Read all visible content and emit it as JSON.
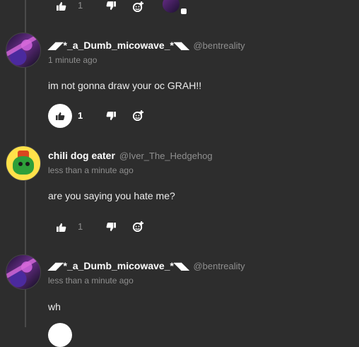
{
  "top_actions": {
    "like_count": "1"
  },
  "comments": [
    {
      "username": "◢◤*_a_Dumb_micowave_*◥◣",
      "handle": "@bentreality",
      "time": "1 minute ago",
      "text": "im not gonna draw your oc GRAH!!",
      "like_count": "1",
      "liked": true
    },
    {
      "username": "chili dog eater",
      "handle": "@Iver_The_Hedgehog",
      "time": "less than a minute ago",
      "text": "are you saying you hate me?",
      "like_count": "1",
      "liked": false
    },
    {
      "username": "◢◤*_a_Dumb_micowave_*◥◣",
      "handle": "@bentreality",
      "time": "less than a minute ago",
      "text": "wh"
    }
  ],
  "icons": {
    "like": "thumbs-up-icon",
    "dislike": "thumbs-down-icon",
    "react": "add-reaction-icon"
  },
  "colors": {
    "background": "#2d2d2d",
    "muted": "#8f8f8f",
    "liked_bg": "#ffffff"
  }
}
